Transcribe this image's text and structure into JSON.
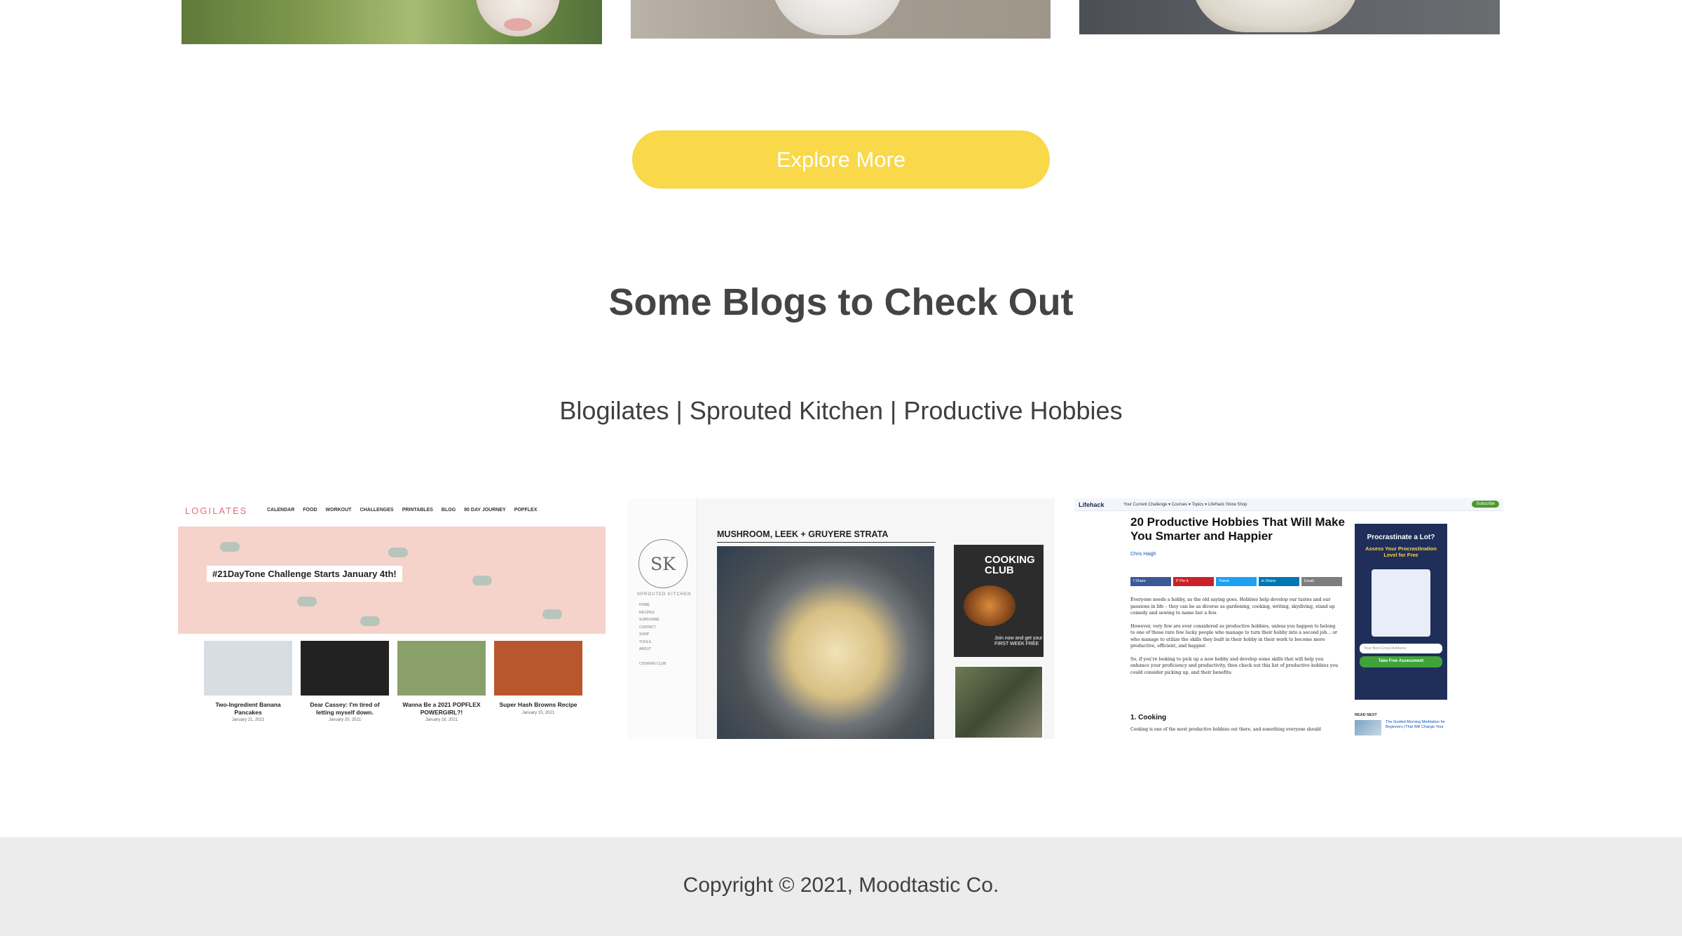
{
  "explore": {
    "label": "Explore More",
    "color": "#f9d84a"
  },
  "blogs": {
    "title": "Some Blogs to Check Out",
    "links": [
      "Blogilates",
      "Sprouted Kitchen",
      "Productive Hobbies"
    ],
    "separator": "|"
  },
  "blogilates": {
    "logo": "LOGILATES",
    "menu": [
      "CALENDAR",
      "FOOD",
      "WORKOUT",
      "CHALLENGES",
      "PRINTABLES",
      "BLOG",
      "90 DAY JOURNEY",
      "POPFLEX"
    ],
    "banner": "#21DayTone Challenge Starts January 4th!",
    "posts": [
      {
        "title": "Two-Ingredient Banana Pancakes",
        "date": "January 21, 2021"
      },
      {
        "title": "Dear Cassey: I'm tired of letting myself down.",
        "date": "January 20, 2021"
      },
      {
        "title": "Wanna Be a 2021 POPFLEX POWERGIRL?!",
        "date": "January 18, 2021"
      },
      {
        "title": "Super Hash Browns Recipe",
        "date": "January 15, 2021"
      }
    ],
    "thumb_colors": [
      "#d8dde3",
      "#222222",
      "#8aa06a",
      "#b8572d"
    ]
  },
  "sprouted": {
    "logo": "SK",
    "name": "SPROUTED KITCHEN",
    "menu": [
      "HOME",
      "RECIPES",
      "SUBSCRIBE",
      "CONTACT",
      "SHOP",
      "TOOLS",
      "ABOUT",
      "",
      "COOKING CLUB"
    ],
    "post_title": "MUSHROOM, LEEK + GRUYERE STRATA",
    "promo_title": "COOKING CLUB",
    "promo_small": "Join now and get your FIRST WEEK FREE"
  },
  "lifehack": {
    "logo": "Lifehack",
    "nav": "Your Current Challenge ▾   Courses ▾   Topics ▾   LifeHack Show   Shop",
    "subscribe": "Subscribe",
    "title": "20 Productive Hobbies That Will Make You Smarter and Happier",
    "author": "Chris Haigh",
    "share": [
      "f Share",
      "P Pin it",
      "Tweet",
      "in Share",
      "Email"
    ],
    "share_colors": [
      "#3b5998",
      "#cb2027",
      "#1da1f2",
      "#0077b5",
      "#7d7d7d"
    ],
    "paragraphs": [
      "Everyone needs a hobby, as the old saying goes. Hobbies help develop our tastes and our passions in life – they can be as diverse as gardening, cooking, writing, skydiving, stand up comedy and sewing to name but a few.",
      "However, very few are ever considered as productive hobbies, unless you happen to belong to one of those rare few lucky people who manage to turn their hobby into a second job... or who manage to utilize the skills they built in their hobby in their work to become more productive, efficient, and happier.",
      "So, if you're looking to pick up a new hobby and develop some skills that will help you enhance your proficiency and productivity, then check out this list of productive hobbies you could consider picking up, and their benefits:"
    ],
    "section": "1. Cooking",
    "section_text": "Cooking is one of the most productive hobbies out there, and something everyone should",
    "ad": {
      "heading": "Procrastinate a Lot?",
      "subheading": "Assess Your Procrastination Level for Free",
      "field": "Your Best Email Address",
      "button": "Take Free Assessment"
    },
    "read_next": "READ NEXT",
    "read_next_title": "The Guided Morning Meditation for Beginners (That Will Change Your"
  },
  "footer": {
    "copyright": "Copyright © 2021, Moodtastic Co."
  }
}
